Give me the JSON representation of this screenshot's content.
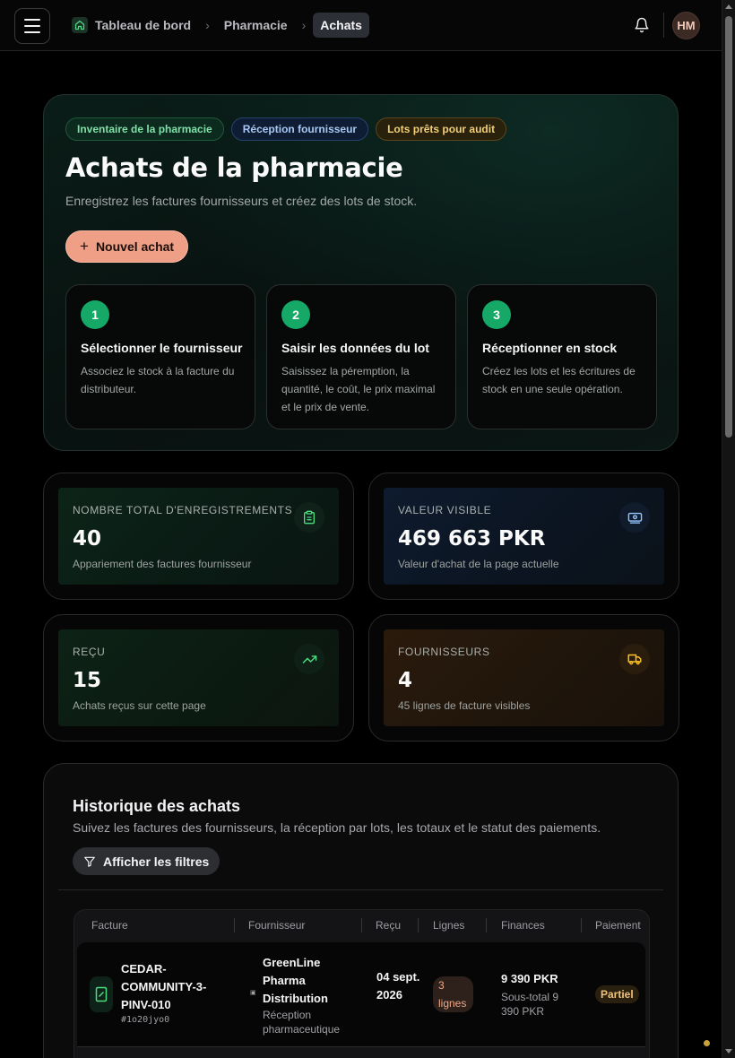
{
  "topbar": {
    "breadcrumbs": [
      {
        "label": "Tableau de bord"
      },
      {
        "label": "Pharmacie"
      },
      {
        "label": "Achats"
      }
    ],
    "avatar_initials": "HM"
  },
  "hero": {
    "tags": [
      "Inventaire de la pharmacie",
      "Réception fournisseur",
      "Lots prêts pour audit"
    ],
    "title": "Achats de la pharmacie",
    "subtitle": "Enregistrez les factures fournisseurs et créez des lots de stock.",
    "new_button": "Nouvel achat",
    "steps": [
      {
        "num": "1",
        "title": "Sélectionner le fournisseur",
        "desc": "Associez le stock à la facture du distributeur."
      },
      {
        "num": "2",
        "title": "Saisir les données du lot",
        "desc": "Saisissez la péremption, la quantité, le coût, le prix maximal et le prix de vente."
      },
      {
        "num": "3",
        "title": "Réceptionner en stock",
        "desc": "Créez les lots et les écritures de stock en une seule opération."
      }
    ]
  },
  "stats": [
    {
      "label": "Nombre total d'enregistrements",
      "value": "40",
      "desc": "Appariement des factures fournisseur",
      "icon": "clipboard-icon",
      "accent": "#22c55e"
    },
    {
      "label": "Valeur visible",
      "value": "469 663 PKR",
      "desc": "Valeur d'achat de la page actuelle",
      "icon": "banknote-icon",
      "accent": "#60a5fa"
    },
    {
      "label": "Reçu",
      "value": "15",
      "desc": "Achats reçus sur cette page",
      "icon": "trending-up-icon",
      "accent": "#22c55e"
    },
    {
      "label": "Fournisseurs",
      "value": "4",
      "desc": "45 lignes de facture visibles",
      "icon": "truck-icon",
      "accent": "#f59e0b"
    }
  ],
  "history": {
    "title": "Historique des achats",
    "subtitle": "Suivez les factures des fournisseurs, la réception par lots, les totaux et le statut des paiements.",
    "filter_button": "Afficher les filtres",
    "columns": [
      "Facture",
      "Fournisseur",
      "Reçu",
      "Lignes",
      "Finances",
      "Paiement"
    ],
    "rows": [
      {
        "invoice": "CEDAR-COMMUNITY-3-PINV-010",
        "code": "#1o20jyo0",
        "supplier": "GreenLine Pharma Distribution",
        "supplier_type": "Réception pharmaceutique",
        "received": "04 sept. 2026",
        "lines": "3 lignes",
        "total": "9 390 PKR",
        "subtotal": "Sous-total 9 390 PKR",
        "payment": "Partiel"
      }
    ]
  }
}
